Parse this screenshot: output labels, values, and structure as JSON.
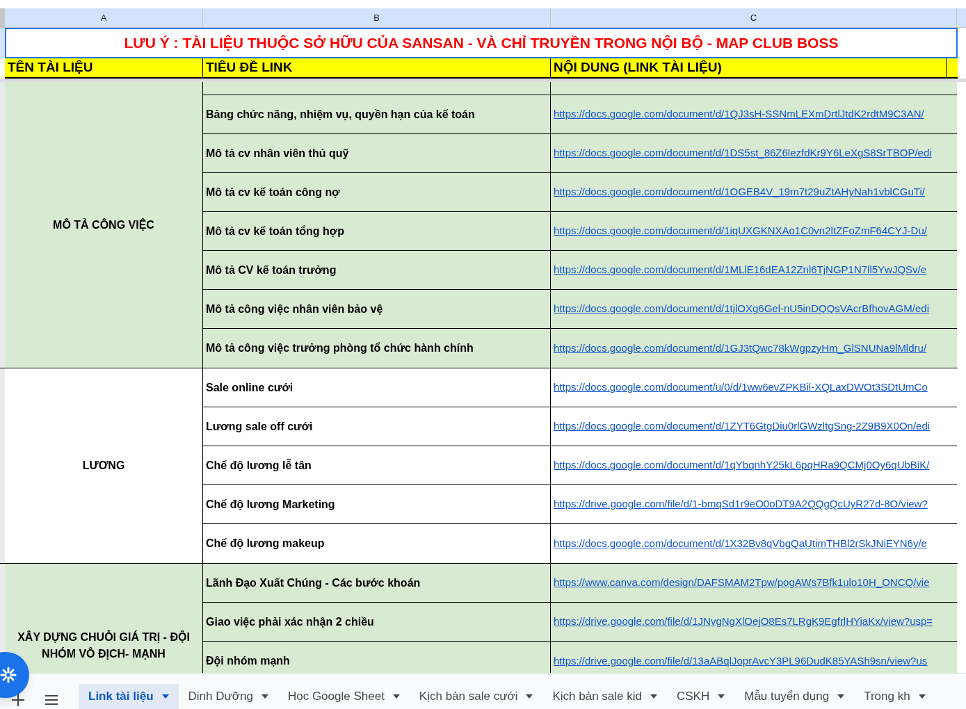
{
  "column_headers": [
    "A",
    "B",
    "C"
  ],
  "notice": "LƯU Ý : TÀI LIỆU THUỘC SỞ HỮU CỦA SANSAN - VÀ CHỈ TRUYỀN TRONG NỘI BỘ - MAP CLUB BOSS",
  "table_headers": [
    "TÊN TÀI LIỆU",
    "TIÊU ĐỀ LINK",
    "NỘI DUNG (LINK TÀI LIỆU)"
  ],
  "groups": [
    {
      "name": "MÔ TẢ CÔNG VIỆC",
      "shaded": true,
      "leading_blank_row": true,
      "rows": [
        {
          "title": "Bảng chức năng, nhiệm vụ, quyền hạn của kế toán",
          "link": "https://docs.google.com/document/d/1QJ3sH-SSNmLEXmDrtlJtdK2rdtM9C3AN/"
        },
        {
          "title": "Mô tả cv nhân viên thủ quỹ",
          "link": "https://docs.google.com/document/d/1DS5st_86Z6lezfdKr9Y6LeXgS8SrTBOP/edi"
        },
        {
          "title": "Mô tả cv kế toán công nợ",
          "link": "https://docs.google.com/document/d/1OGEB4V_19m7t29uZtAHyNah1vblCGuTi/"
        },
        {
          "title": "Mô tả cv kế toán tổng hợp",
          "link": "https://docs.google.com/document/d/1iqUXGKNXAo1C0vn2ltZFoZmF64CYJ-Du/"
        },
        {
          "title": "Mô tả CV kế toán trưởng",
          "link": "https://docs.google.com/document/d/1MLlE16dEA12Znl6TjNGP1N7ll5YwJQSv/e"
        },
        {
          "title": "Mô tả công việc nhân viên bảo vệ",
          "link": "https://docs.google.com/document/d/1tjlOXg6Gel-nU5inDQQsVAcrBfhovAGM/edi"
        },
        {
          "title": "Mô tả công việc trưởng phòng tổ chức hành chính",
          "link": "https://docs.google.com/document/d/1GJ3tQwc78kWgpzyHm_GlSNUNa9lMldru/"
        }
      ]
    },
    {
      "name": "LƯƠNG",
      "shaded": false,
      "leading_blank_row": false,
      "rows": [
        {
          "title": "Sale online cưới",
          "link": "https://docs.google.com/document/u/0/d/1ww6evZPKBil-XQLaxDWOt3SDtUmCo"
        },
        {
          "title": "Lương sale off cưới",
          "link": "https://docs.google.com/document/d/1ZYT6GtgDiu0rlGWzltgSng-2Z9B9X0On/edi"
        },
        {
          "title": "Chế độ lương lễ tân",
          "link": "https://docs.google.com/document/d/1qYbqnhY25kL6pqHRa9QCMj0Oy6qUbBiK/"
        },
        {
          "title": "Chế độ lương Marketing",
          "link": "https://drive.google.com/file/d/1-bmqSd1r9eO0oDT9A2QQgQcUyR27d-8O/view?"
        },
        {
          "title": "Chế độ lương makeup",
          "link": "https://docs.google.com/document/d/1X32Bv8qVbgQaUtimTHBl2rSkJNiEYN6y/e"
        }
      ]
    },
    {
      "name": "XÂY DỰNG CHUỖI GIÁ TRỊ - ĐỘI NHÓM VÔ ĐỊCH- MẠNH",
      "shaded": true,
      "leading_blank_row": false,
      "rows": [
        {
          "title": "Lãnh Đạo Xuất Chúng - Các bước khoán",
          "link": "https://www.canva.com/design/DAFSMAM2Tpw/pogAWs7Bfk1ulo10H_ONCQ/vie"
        },
        {
          "title": "Giao việc phải xác nhận 2 chiều",
          "link": "https://drive.google.com/file/d/1JNvgNgXlOejO8Es7LRgK9EgfrlHYiaKx/view?usp="
        },
        {
          "title": "Đội nhóm mạnh",
          "link": "https://drive.google.com/file/d/13aABqlJoprAvcY3PL96DudK85YASh9sn/view?us"
        }
      ]
    }
  ],
  "sheet_tabs": [
    {
      "label": "Link tài liệu",
      "selected": true
    },
    {
      "label": "Dinh Dưỡng",
      "selected": false
    },
    {
      "label": "Học Google Sheet",
      "selected": false
    },
    {
      "label": "Kịch bản sale cưới",
      "selected": false
    },
    {
      "label": "Kịch bản sale kid",
      "selected": false
    },
    {
      "label": "CSKH",
      "selected": false
    },
    {
      "label": "Mẫu tuyển dụng",
      "selected": false
    },
    {
      "label": "Trong kh",
      "selected": false
    }
  ]
}
